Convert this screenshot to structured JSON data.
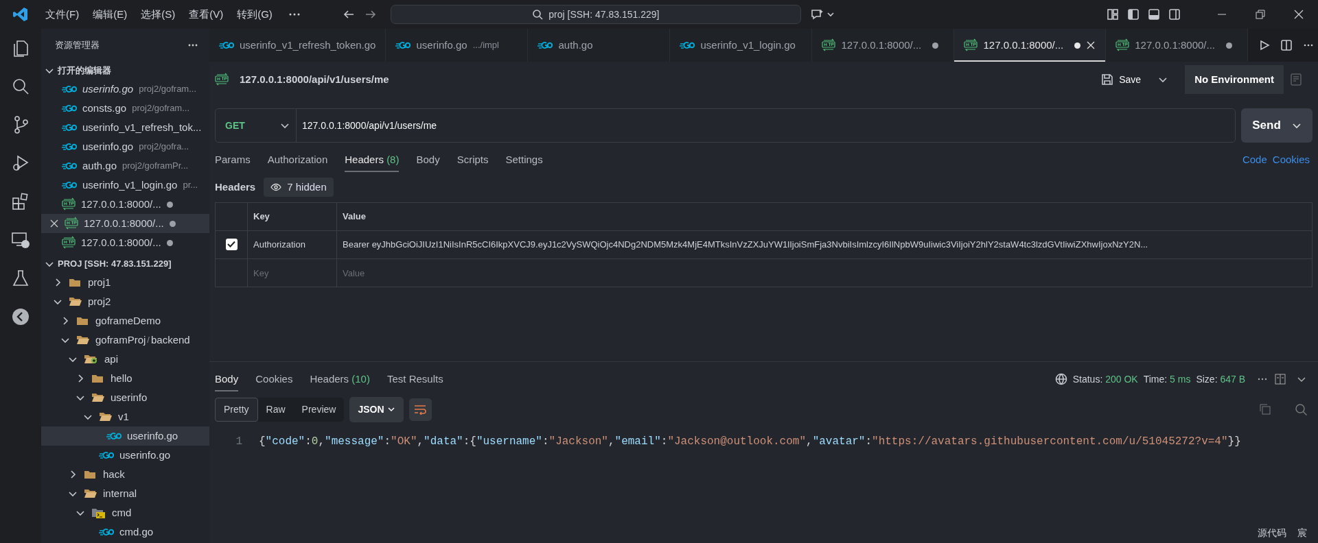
{
  "window": {
    "menu": [
      "文件(F)",
      "编辑(E)",
      "选择(S)",
      "查看(V)",
      "转到(G)"
    ],
    "search": "proj [SSH: 47.83.151.229]"
  },
  "sidebar": {
    "title": "资源管理器",
    "open_editors": {
      "title": "打开的编辑器",
      "expanded": true,
      "items": [
        {
          "kind": "go",
          "name": "userinfo.go",
          "path": "proj2/gofram...",
          "preview": true,
          "selected": false,
          "dirty": false
        },
        {
          "kind": "go",
          "name": "consts.go",
          "path": "proj2/gofram...",
          "preview": false,
          "selected": false,
          "dirty": false
        },
        {
          "kind": "go",
          "name": "userinfo_v1_refresh_tok...",
          "preview": false,
          "selected": false,
          "dirty": false
        },
        {
          "kind": "go",
          "name": "userinfo.go",
          "path": "proj2/gofra...",
          "preview": false,
          "selected": false,
          "dirty": false
        },
        {
          "kind": "go",
          "name": "auth.go",
          "path": "proj2/goframPr...",
          "preview": false,
          "selected": false,
          "dirty": false
        },
        {
          "kind": "go",
          "name": "userinfo_v1_login.go",
          "path": "pr...",
          "preview": false,
          "selected": false,
          "dirty": false
        },
        {
          "kind": "http",
          "name": "127.0.0.1:8000/...",
          "preview": false,
          "selected": false,
          "dirty": true
        },
        {
          "kind": "http",
          "name": "127.0.0.1:8000/...",
          "preview": false,
          "selected": true,
          "dirty": true
        },
        {
          "kind": "http",
          "name": "127.0.0.1:8000/...",
          "preview": false,
          "selected": false,
          "dirty": true
        }
      ]
    },
    "explorer": {
      "title": "PROJ [SSH: 47.83.151.229]",
      "expanded": true,
      "tree": [
        {
          "kind": "folder",
          "name": "proj1",
          "expanded": false,
          "selected": false
        },
        {
          "kind": "folder",
          "name": "proj2",
          "expanded": true,
          "selected": false,
          "children": [
            {
              "kind": "folder",
              "name": "goframeDemo",
              "expanded": false,
              "selected": false
            },
            {
              "kind": "folder",
              "name": "goframProj",
              "separator": "/",
              "compact_child": "backend",
              "expanded": true,
              "selected": false,
              "children": [
                {
                  "kind": "folder-api",
                  "name": "api",
                  "expanded": true,
                  "selected": false,
                  "children": [
                    {
                      "kind": "folder",
                      "name": "hello",
                      "expanded": false,
                      "selected": false
                    },
                    {
                      "kind": "folder",
                      "name": "userinfo",
                      "expanded": true,
                      "selected": false,
                      "children": [
                        {
                          "kind": "folder",
                          "name": "v1",
                          "expanded": true,
                          "selected": false,
                          "children": [
                            {
                              "kind": "go",
                              "name": "userinfo.go",
                              "selected": true
                            }
                          ]
                        },
                        {
                          "kind": "go",
                          "name": "userinfo.go",
                          "selected": false
                        }
                      ]
                    }
                  ]
                },
                {
                  "kind": "folder",
                  "name": "hack",
                  "expanded": false,
                  "selected": false
                },
                {
                  "kind": "folder",
                  "name": "internal",
                  "expanded": true,
                  "selected": false,
                  "children": [
                    {
                      "kind": "folder-cmd",
                      "name": "cmd",
                      "expanded": true,
                      "selected": false,
                      "children": [
                        {
                          "kind": "go",
                          "name": "cmd.go",
                          "selected": false
                        }
                      ]
                    }
                  ]
                }
              ]
            }
          ]
        }
      ]
    }
  },
  "editor_tabs": [
    {
      "kind": "go",
      "label": "userinfo_v1_refresh_token.go",
      "selected": false,
      "dirty": false
    },
    {
      "kind": "go",
      "label": "userinfo.go",
      "detail": ".../impl",
      "selected": false,
      "dirty": false
    },
    {
      "kind": "go",
      "label": "auth.go",
      "selected": false,
      "dirty": false
    },
    {
      "kind": "go",
      "label": "userinfo_v1_login.go",
      "selected": false,
      "dirty": false
    },
    {
      "kind": "http",
      "label": "127.0.0.1:8000/...",
      "selected": false,
      "dirty": true
    },
    {
      "kind": "http",
      "label": "127.0.0.1:8000/...",
      "selected": true,
      "dirty": true
    },
    {
      "kind": "http",
      "label": "127.0.0.1:8000/...",
      "selected": false,
      "dirty": true
    }
  ],
  "request": {
    "title": "127.0.0.1:8000/api/v1/users/me",
    "save": "Save",
    "environment": "No Environment",
    "method": "GET",
    "url": "127.0.0.1:8000/api/v1/users/me",
    "send": "Send",
    "tabs": [
      {
        "label": "Params",
        "selected": false
      },
      {
        "label": "Authorization",
        "selected": false
      },
      {
        "label": "Headers",
        "count": "(8)",
        "selected": true
      },
      {
        "label": "Body",
        "selected": false
      },
      {
        "label": "Scripts",
        "selected": false
      },
      {
        "label": "Settings",
        "selected": false
      }
    ],
    "links": [
      "Code",
      "Cookies"
    ],
    "headers_label": "Headers",
    "hidden": "7 hidden",
    "table": {
      "columns": [
        "Key",
        "Value"
      ],
      "rows": [
        {
          "checked": true,
          "key": "Authorization",
          "value": "Bearer eyJhbGciOiJIUzI1NiIsInR5cCI6IkpXVCJ9.eyJ1c2VySWQiOjc4NDg2NDM5Mzk4MjE4MTksInVzZXJuYW1lIjoiSmFja3NvbiIsImlzcyI6IlNpbW9uIiwic3ViIjoiY2hlY2staW4tc3lzdGVtIiwiZXhwIjoxNzY2N..."
        }
      ],
      "empty_row": {
        "key": {
          "placeholder": "Key"
        },
        "value": {
          "placeholder": "Value"
        }
      }
    }
  },
  "response": {
    "tabs": [
      {
        "label": "Body",
        "selected": true
      },
      {
        "label": "Cookies",
        "selected": false
      },
      {
        "label": "Headers",
        "count": "(10)",
        "selected": false
      },
      {
        "label": "Test Results",
        "selected": false
      }
    ],
    "status": {
      "label": "Status:",
      "value": "200 OK"
    },
    "time": {
      "label": "Time:",
      "value": "5 ms"
    },
    "size": {
      "label": "Size:",
      "value": "647 B"
    },
    "views": [
      {
        "label": "Pretty",
        "selected": true
      },
      {
        "label": "Raw",
        "selected": false
      },
      {
        "label": "Preview",
        "selected": false
      }
    ],
    "format": "JSON",
    "lines": [
      {
        "number": "1",
        "tokens": [
          {
            "kind": "p",
            "text": "{"
          },
          {
            "kind": "key",
            "text": "\"code\""
          },
          {
            "kind": "p",
            "text": ":"
          },
          {
            "kind": "num",
            "text": "0"
          },
          {
            "kind": "p",
            "text": ","
          },
          {
            "kind": "key",
            "text": "\"message\""
          },
          {
            "kind": "p",
            "text": ":"
          },
          {
            "kind": "str",
            "text": "\"OK\""
          },
          {
            "kind": "p",
            "text": ","
          },
          {
            "kind": "key",
            "text": "\"data\""
          },
          {
            "kind": "p",
            "text": ":{"
          },
          {
            "kind": "key",
            "text": "\"username\""
          },
          {
            "kind": "p",
            "text": ":"
          },
          {
            "kind": "str",
            "text": "\"Jackson\""
          },
          {
            "kind": "p",
            "text": ","
          },
          {
            "kind": "key",
            "text": "\"email\""
          },
          {
            "kind": "p",
            "text": ":"
          },
          {
            "kind": "str",
            "text": "\"Jackson@outlook.com\""
          },
          {
            "kind": "p",
            "text": ","
          },
          {
            "kind": "key",
            "text": "\"avatar\""
          },
          {
            "kind": "p",
            "text": ":"
          },
          {
            "kind": "str",
            "text": "\"https://avatars.githubusercontent.com/u/51045272?v=4\""
          },
          {
            "kind": "p",
            "text": "}}"
          }
        ]
      }
    ]
  },
  "status_bar": [
    "源代码",
    "宸"
  ]
}
